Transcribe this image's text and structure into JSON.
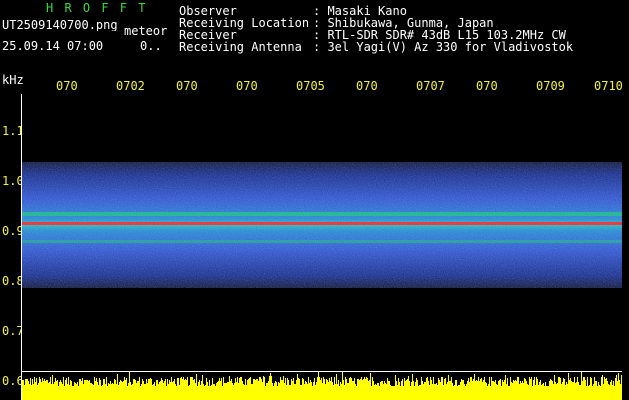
{
  "header": {
    "logo": "H R O F F T",
    "filename": "UT2509140700.png",
    "meteor": "meteor",
    "datetime": "25.09.14 07:00",
    "count": "0.."
  },
  "info": {
    "labels": [
      "Observer",
      "Receiving Location",
      "Receiver",
      "Receiving Antenna"
    ],
    "values": [
      ": Masaki Kano",
      ": Shibukawa, Gunma, Japan",
      ": RTL-SDR SDR# 43dB L15 103.2MHz CW",
      ": 3el Yagi(V) Az 330 for Vladivostok"
    ]
  },
  "axis": {
    "unit": "kHz",
    "y_ticks": [
      "1.1",
      "1.0",
      "0.9",
      "0.8",
      "0.7",
      "0.6"
    ],
    "time_ticks": [
      "070",
      "0702",
      "070",
      "070",
      "0705",
      "070",
      "0707",
      "070",
      "0709",
      "0710"
    ]
  },
  "colors": {
    "background": "#000000",
    "logo": "#39d83a",
    "text": "#ffffff",
    "ticks": "#f3f33a",
    "noise_band": "#2a4bd8",
    "signal_line": "#ff3030",
    "bottom_bars": "#ffff00"
  }
}
